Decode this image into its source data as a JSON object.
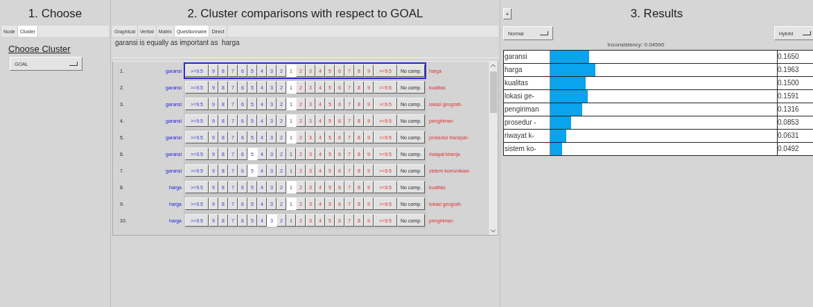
{
  "choose": {
    "title": "1. Choose",
    "tabs": [
      {
        "label": "Node",
        "selected": false
      },
      {
        "label": "Cluster",
        "selected": true
      }
    ],
    "heading": "Choose Cluster",
    "dropdown": "GOAL"
  },
  "compare": {
    "title": "2. Cluster comparisons with respect to GOAL",
    "tabs": [
      {
        "label": "Graphical",
        "selected": false
      },
      {
        "label": "Verbal",
        "selected": false
      },
      {
        "label": "Matrix",
        "selected": false
      },
      {
        "label": "Questionnaire",
        "selected": true
      },
      {
        "label": "Direct",
        "selected": false
      }
    ],
    "statement": "garansi is equally as important as  harga",
    "rows": [
      {
        "number": "1.",
        "left": "garansi",
        "current": true,
        "left_scale": [
          {
            "label": ">=9.5",
            "selected": false
          },
          {
            "label": "9",
            "selected": false
          },
          {
            "label": "8",
            "selected": false
          },
          {
            "label": "7",
            "selected": false
          },
          {
            "label": "6",
            "selected": false
          },
          {
            "label": "5",
            "selected": false
          },
          {
            "label": "4",
            "selected": false
          },
          {
            "label": "3",
            "selected": false
          },
          {
            "label": "2",
            "selected": false
          }
        ],
        "equal": {
          "label": "1",
          "selected": true
        },
        "right_scale": [
          {
            "label": "2",
            "selected": false
          },
          {
            "label": "3",
            "selected": false
          },
          {
            "label": "4",
            "selected": false
          },
          {
            "label": "5",
            "selected": false
          },
          {
            "label": "6",
            "selected": false
          },
          {
            "label": "7",
            "selected": false
          },
          {
            "label": "8",
            "selected": false
          },
          {
            "label": "9",
            "selected": false
          },
          {
            "label": ">=9.5",
            "selected": false
          }
        ],
        "no_comp": {
          "label": "No comp.",
          "selected": false
        },
        "right": "harga"
      },
      {
        "number": "2.",
        "left": "garansi",
        "current": false,
        "left_scale": [
          {
            "label": ">=9.5",
            "selected": false
          },
          {
            "label": "9",
            "selected": false
          },
          {
            "label": "8",
            "selected": false
          },
          {
            "label": "7",
            "selected": false
          },
          {
            "label": "6",
            "selected": false
          },
          {
            "label": "5",
            "selected": false
          },
          {
            "label": "4",
            "selected": false
          },
          {
            "label": "3",
            "selected": false
          },
          {
            "label": "2",
            "selected": false
          }
        ],
        "equal": {
          "label": "1",
          "selected": true
        },
        "right_scale": [
          {
            "label": "2",
            "selected": false
          },
          {
            "label": "3",
            "selected": false
          },
          {
            "label": "4",
            "selected": false
          },
          {
            "label": "5",
            "selected": false
          },
          {
            "label": "6",
            "selected": false
          },
          {
            "label": "7",
            "selected": false
          },
          {
            "label": "8",
            "selected": false
          },
          {
            "label": "9",
            "selected": false
          },
          {
            "label": ">=9.5",
            "selected": false
          }
        ],
        "no_comp": {
          "label": "No comp.",
          "selected": false
        },
        "right": "kualitas"
      },
      {
        "number": "3.",
        "left": "garansi",
        "current": false,
        "left_scale": [
          {
            "label": ">=9.5",
            "selected": false
          },
          {
            "label": "9",
            "selected": false
          },
          {
            "label": "8",
            "selected": false
          },
          {
            "label": "7",
            "selected": false
          },
          {
            "label": "6",
            "selected": false
          },
          {
            "label": "5",
            "selected": false
          },
          {
            "label": "4",
            "selected": false
          },
          {
            "label": "3",
            "selected": false
          },
          {
            "label": "2",
            "selected": false
          }
        ],
        "equal": {
          "label": "1",
          "selected": true
        },
        "right_scale": [
          {
            "label": "2",
            "selected": false
          },
          {
            "label": "3",
            "selected": false
          },
          {
            "label": "4",
            "selected": false
          },
          {
            "label": "5",
            "selected": false
          },
          {
            "label": "6",
            "selected": false
          },
          {
            "label": "7",
            "selected": false
          },
          {
            "label": "8",
            "selected": false
          },
          {
            "label": "9",
            "selected": false
          },
          {
            "label": ">=9.5",
            "selected": false
          }
        ],
        "no_comp": {
          "label": "No comp.",
          "selected": false
        },
        "right": "lokasi geografi-"
      },
      {
        "number": "4.",
        "left": "garansi",
        "current": false,
        "left_scale": [
          {
            "label": ">=9.5",
            "selected": false
          },
          {
            "label": "9",
            "selected": false
          },
          {
            "label": "8",
            "selected": false
          },
          {
            "label": "7",
            "selected": false
          },
          {
            "label": "6",
            "selected": false
          },
          {
            "label": "5",
            "selected": false
          },
          {
            "label": "4",
            "selected": false
          },
          {
            "label": "3",
            "selected": false
          },
          {
            "label": "2",
            "selected": false
          }
        ],
        "equal": {
          "label": "1",
          "selected": true
        },
        "right_scale": [
          {
            "label": "2",
            "selected": false
          },
          {
            "label": "3",
            "selected": false
          },
          {
            "label": "4",
            "selected": false
          },
          {
            "label": "5",
            "selected": false
          },
          {
            "label": "6",
            "selected": false
          },
          {
            "label": "7",
            "selected": false
          },
          {
            "label": "8",
            "selected": false
          },
          {
            "label": "9",
            "selected": false
          },
          {
            "label": ">=9.5",
            "selected": false
          }
        ],
        "no_comp": {
          "label": "No comp.",
          "selected": false
        },
        "right": "pengiriman"
      },
      {
        "number": "5.",
        "left": "garansi",
        "current": false,
        "left_scale": [
          {
            "label": ">=9.5",
            "selected": false
          },
          {
            "label": "9",
            "selected": false
          },
          {
            "label": "8",
            "selected": false
          },
          {
            "label": "7",
            "selected": false
          },
          {
            "label": "6",
            "selected": false
          },
          {
            "label": "5",
            "selected": false
          },
          {
            "label": "4",
            "selected": false
          },
          {
            "label": "3",
            "selected": false
          },
          {
            "label": "2",
            "selected": false
          }
        ],
        "equal": {
          "label": "1",
          "selected": true
        },
        "right_scale": [
          {
            "label": "2",
            "selected": false
          },
          {
            "label": "3",
            "selected": false
          },
          {
            "label": "4",
            "selected": false
          },
          {
            "label": "5",
            "selected": false
          },
          {
            "label": "6",
            "selected": false
          },
          {
            "label": "7",
            "selected": false
          },
          {
            "label": "8",
            "selected": false
          },
          {
            "label": "9",
            "selected": false
          },
          {
            "label": ">=9.5",
            "selected": false
          }
        ],
        "no_comp": {
          "label": "No comp.",
          "selected": false
        },
        "right": "prosedur transpar-"
      },
      {
        "number": "6.",
        "left": "garansi",
        "current": false,
        "left_scale": [
          {
            "label": ">=9.5",
            "selected": false
          },
          {
            "label": "9",
            "selected": false
          },
          {
            "label": "8",
            "selected": false
          },
          {
            "label": "7",
            "selected": false
          },
          {
            "label": "6",
            "selected": false
          },
          {
            "label": "5",
            "selected": true
          },
          {
            "label": "4",
            "selected": false
          },
          {
            "label": "3",
            "selected": false
          },
          {
            "label": "2",
            "selected": false
          }
        ],
        "equal": {
          "label": "1",
          "selected": false
        },
        "right_scale": [
          {
            "label": "2",
            "selected": false
          },
          {
            "label": "3",
            "selected": false
          },
          {
            "label": "4",
            "selected": false
          },
          {
            "label": "5",
            "selected": false
          },
          {
            "label": "6",
            "selected": false
          },
          {
            "label": "7",
            "selected": false
          },
          {
            "label": "8",
            "selected": false
          },
          {
            "label": "9",
            "selected": false
          },
          {
            "label": ">=9.5",
            "selected": false
          }
        ],
        "no_comp": {
          "label": "No comp.",
          "selected": false
        },
        "right": "riwayat kinerja"
      },
      {
        "number": "7.",
        "left": "garansi",
        "current": false,
        "left_scale": [
          {
            "label": ">=9.5",
            "selected": false
          },
          {
            "label": "9",
            "selected": false
          },
          {
            "label": "8",
            "selected": false
          },
          {
            "label": "7",
            "selected": false
          },
          {
            "label": "6",
            "selected": false
          },
          {
            "label": "5",
            "selected": true
          },
          {
            "label": "4",
            "selected": false
          },
          {
            "label": "3",
            "selected": false
          },
          {
            "label": "2",
            "selected": false
          }
        ],
        "equal": {
          "label": "1",
          "selected": false
        },
        "right_scale": [
          {
            "label": "2",
            "selected": false
          },
          {
            "label": "3",
            "selected": false
          },
          {
            "label": "4",
            "selected": false
          },
          {
            "label": "5",
            "selected": false
          },
          {
            "label": "6",
            "selected": false
          },
          {
            "label": "7",
            "selected": false
          },
          {
            "label": "8",
            "selected": false
          },
          {
            "label": "9",
            "selected": false
          },
          {
            "label": ">=9.5",
            "selected": false
          }
        ],
        "no_comp": {
          "label": "No comp.",
          "selected": false
        },
        "right": "sistem komunikasi-"
      },
      {
        "number": "8.",
        "left": "harga",
        "current": false,
        "left_scale": [
          {
            "label": ">=9.5",
            "selected": false
          },
          {
            "label": "9",
            "selected": false
          },
          {
            "label": "8",
            "selected": false
          },
          {
            "label": "7",
            "selected": false
          },
          {
            "label": "6",
            "selected": false
          },
          {
            "label": "5",
            "selected": false
          },
          {
            "label": "4",
            "selected": false
          },
          {
            "label": "3",
            "selected": false
          },
          {
            "label": "2",
            "selected": false
          }
        ],
        "equal": {
          "label": "1",
          "selected": true
        },
        "right_scale": [
          {
            "label": "2",
            "selected": false
          },
          {
            "label": "3",
            "selected": false
          },
          {
            "label": "4",
            "selected": false
          },
          {
            "label": "5",
            "selected": false
          },
          {
            "label": "6",
            "selected": false
          },
          {
            "label": "7",
            "selected": false
          },
          {
            "label": "8",
            "selected": false
          },
          {
            "label": "9",
            "selected": false
          },
          {
            "label": ">=9.5",
            "selected": false
          }
        ],
        "no_comp": {
          "label": "No comp.",
          "selected": false
        },
        "right": "kualitas"
      },
      {
        "number": "9.",
        "left": "harga",
        "current": false,
        "left_scale": [
          {
            "label": ">=9.5",
            "selected": false
          },
          {
            "label": "9",
            "selected": false
          },
          {
            "label": "8",
            "selected": false
          },
          {
            "label": "7",
            "selected": false
          },
          {
            "label": "6",
            "selected": false
          },
          {
            "label": "5",
            "selected": false
          },
          {
            "label": "4",
            "selected": false
          },
          {
            "label": "3",
            "selected": false
          },
          {
            "label": "2",
            "selected": false
          }
        ],
        "equal": {
          "label": "1",
          "selected": true
        },
        "right_scale": [
          {
            "label": "2",
            "selected": false
          },
          {
            "label": "3",
            "selected": false
          },
          {
            "label": "4",
            "selected": false
          },
          {
            "label": "5",
            "selected": false
          },
          {
            "label": "6",
            "selected": false
          },
          {
            "label": "7",
            "selected": false
          },
          {
            "label": "8",
            "selected": false
          },
          {
            "label": "9",
            "selected": false
          },
          {
            "label": ">=9.5",
            "selected": false
          }
        ],
        "no_comp": {
          "label": "No comp.",
          "selected": false
        },
        "right": "lokasi geografi-"
      },
      {
        "number": "10.",
        "left": "harga",
        "current": false,
        "left_scale": [
          {
            "label": ">=9.5",
            "selected": false
          },
          {
            "label": "9",
            "selected": false
          },
          {
            "label": "8",
            "selected": false
          },
          {
            "label": "7",
            "selected": false
          },
          {
            "label": "6",
            "selected": false
          },
          {
            "label": "5",
            "selected": false
          },
          {
            "label": "4",
            "selected": false
          },
          {
            "label": "3",
            "selected": true
          },
          {
            "label": "2",
            "selected": false
          }
        ],
        "equal": {
          "label": "1",
          "selected": false
        },
        "right_scale": [
          {
            "label": "2",
            "selected": false
          },
          {
            "label": "3",
            "selected": false
          },
          {
            "label": "4",
            "selected": false
          },
          {
            "label": "5",
            "selected": false
          },
          {
            "label": "6",
            "selected": false
          },
          {
            "label": "7",
            "selected": false
          },
          {
            "label": "8",
            "selected": false
          },
          {
            "label": "9",
            "selected": false
          },
          {
            "label": ">=9.5",
            "selected": false
          }
        ],
        "no_comp": {
          "label": "No comp.",
          "selected": false
        },
        "right": "pengiriman"
      }
    ]
  },
  "results": {
    "expand_button": "+",
    "title": "3. Results",
    "mode_dropdown": "Normal",
    "method_dropdown": "Hybrid",
    "inconsistency": "Inconsistency: 0.04590",
    "items": [
      {
        "name": "garansi",
        "level": 0.17,
        "value": "0.1650"
      },
      {
        "name": "harga",
        "level": 0.2,
        "value": "0.1963"
      },
      {
        "name": "kualitas",
        "level": 0.157,
        "value": "0.1500"
      },
      {
        "name": "lokasi ge-",
        "level": 0.166,
        "value": "0.1591"
      },
      {
        "name": "pengiriman",
        "level": 0.14,
        "value": "0.1316"
      },
      {
        "name": "prosedur -",
        "level": 0.092,
        "value": "0.0853"
      },
      {
        "name": "riwayat k-",
        "level": 0.07,
        "value": "0.0631"
      },
      {
        "name": "sistem ko-",
        "level": 0.052,
        "value": "0.0492"
      }
    ]
  }
}
